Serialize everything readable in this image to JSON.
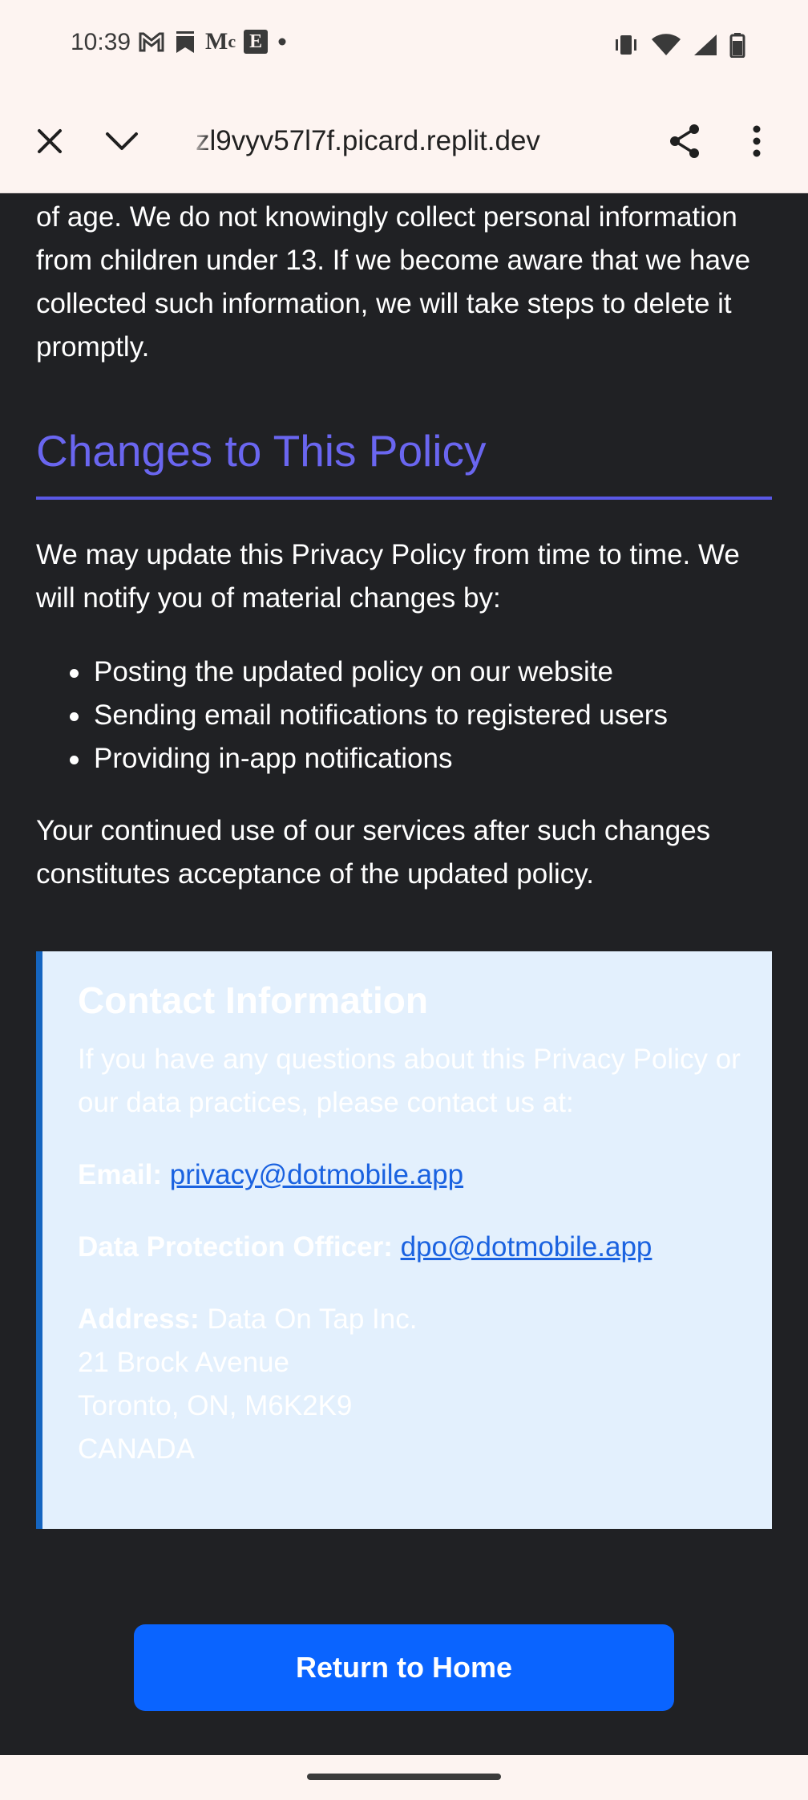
{
  "status_bar": {
    "time": "10:39",
    "notifications": [
      "gmail-icon",
      "bookmark-icon",
      "medium-icon",
      "e-app-icon",
      "more-dot-icon"
    ],
    "notif_text": {
      "medium": "M",
      "e_app": "E",
      "gmail": "M"
    },
    "system_icons": [
      "vibrate-icon",
      "wifi-icon",
      "signal-icon",
      "battery-icon"
    ]
  },
  "browser": {
    "url": "zl9vyv57l7f.picard.replit.dev",
    "close_icon": "close-icon",
    "menu_icon": "chevron-down-icon",
    "share_icon": "share-icon",
    "more_icon": "more-vert-icon"
  },
  "content": {
    "intro_paragraph": "of age. We do not knowingly collect personal information from children under 13. If we become aware that we have collected such information, we will take steps to delete it promptly.",
    "section_heading": "Changes to This Policy",
    "section_paragraph": "We may update this Privacy Policy from time to time. We will notify you of material changes by:",
    "bullets": [
      "Posting the updated policy on our website",
      "Sending email notifications to registered users",
      "Providing in-app notifications"
    ],
    "closing_paragraph": "Your continued use of our services after such changes constitutes acceptance of the updated policy."
  },
  "contact": {
    "title": "Contact Information",
    "intro": "If you have any questions about this Privacy Policy or our data practices, please contact us at:",
    "email_label": "Email:",
    "email": "privacy@dotmobile.app",
    "dpo_label": "Data Protection Officer:",
    "dpo_email": "dpo@dotmobile.app",
    "address_label": "Address:",
    "address_line1": "Data On Tap Inc.",
    "address_line2": "21 Brock Avenue",
    "address_line3": "Toronto, ON, M6K2K9",
    "address_line4": "CANADA"
  },
  "home_button": {
    "label": "Return to Home"
  },
  "colors": {
    "page_background": "#202124",
    "heading": "#6a66f0",
    "contact_background": "#e3f0fd",
    "contact_border": "#1565c0",
    "link": "#1a62e0",
    "button": "#0a64ff"
  }
}
